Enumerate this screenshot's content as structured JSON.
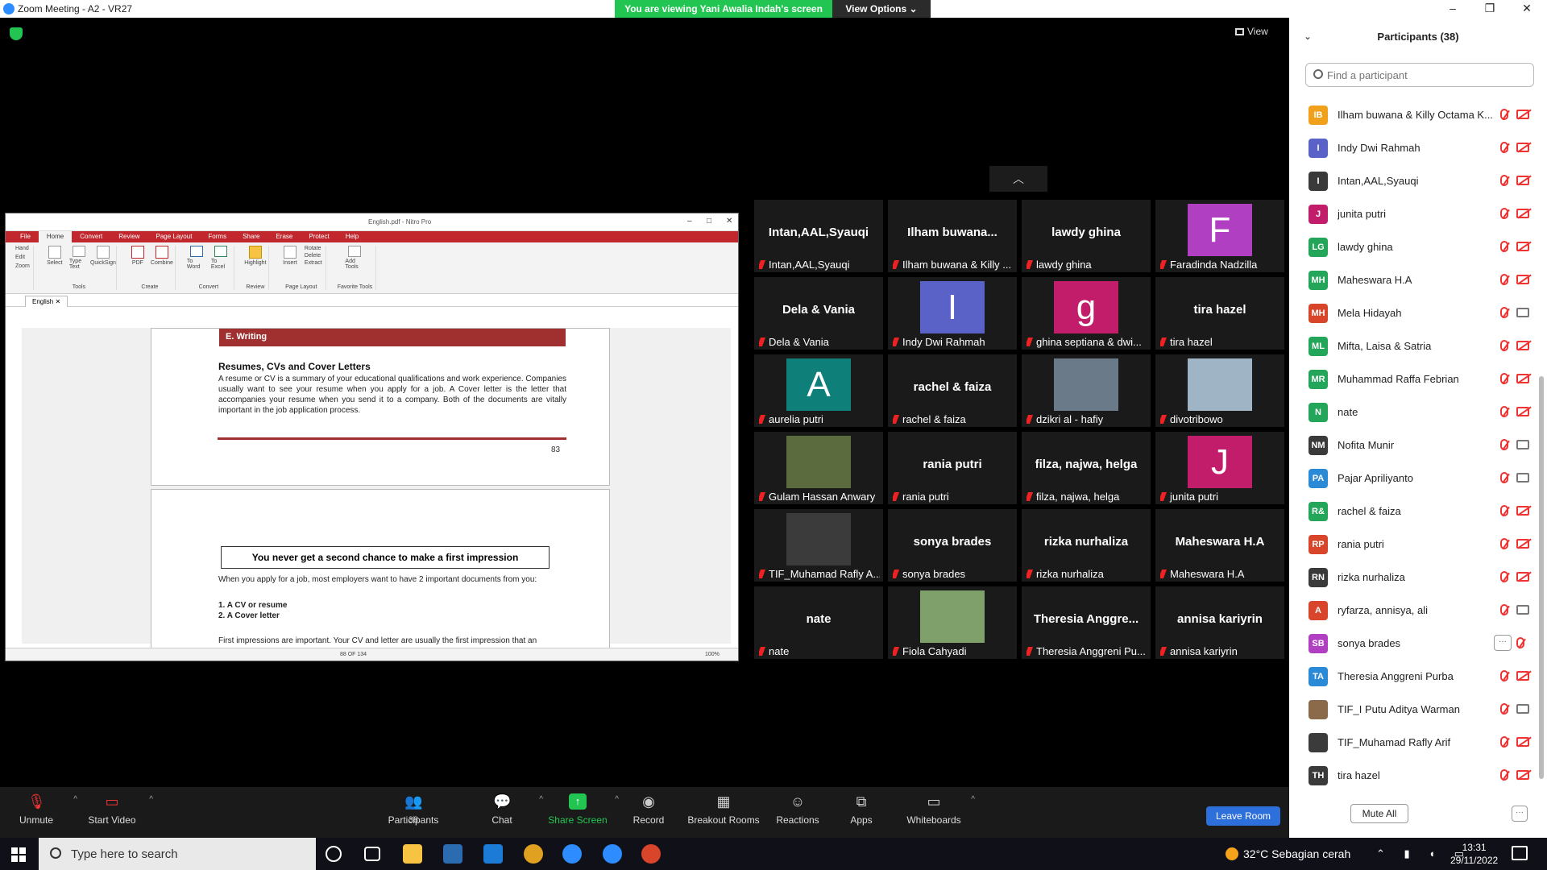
{
  "window": {
    "title": "Zoom Meeting - A2 - VR27"
  },
  "banner": {
    "text": "You are viewing Yani Awalia Indah's screen",
    "view_options": "View Options"
  },
  "view_label": "View",
  "shared_screen": {
    "app_title": "English.pdf - Nitro Pro",
    "menu": [
      "File",
      "Home",
      "Convert",
      "Review",
      "Page Layout",
      "Forms",
      "Share",
      "Erase",
      "Protect",
      "Help"
    ],
    "ribbon_groups": [
      {
        "name": "Tools",
        "items": [
          "Select",
          "Type Text",
          "QuickSign"
        ]
      },
      {
        "name": "Create",
        "items": [
          "PDF",
          "Combine"
        ]
      },
      {
        "name": "Convert",
        "items": [
          "To Word",
          "To Excel"
        ]
      },
      {
        "name": "Review",
        "items": [
          "Highlight"
        ]
      },
      {
        "name": "Page Layout",
        "items": [
          "Insert",
          "Rotate",
          "Delete",
          "Extract"
        ]
      },
      {
        "name": "Favorite Tools",
        "items": [
          "Add Tools"
        ]
      }
    ],
    "side_tools": [
      "Hand",
      "Edit",
      "Zoom"
    ],
    "doc_tab": "English",
    "section_bar": "E. Writing",
    "section_heading": "Resumes, CVs and Cover Letters",
    "section_para": "A resume or CV is a summary of your educational qualifications and work experience. Companies usually want to see your resume when you apply for a job. A Cover letter is the letter that accompanies your resume when you send it to a company. Both of the documents are vitally important in the job application process.",
    "page_number": "83",
    "box_title": "You never get a second chance to make a first impression",
    "p2_intro": "When you apply for a job, most employers want to have 2 important documents from you:",
    "p2_li1": "1. A CV or resume",
    "p2_li2": "2. A Cover letter",
    "p2_first": "First impressions are important. Your CV and letter are usually the first impression that an",
    "page_counter": "88 OF 134",
    "zoom_level": "100%"
  },
  "video_tiles": [
    {
      "label": "Intan,AAL,Syauqi",
      "big": "Intan,AAL,Syauqi"
    },
    {
      "label": "Ilham buwana & Killy ...",
      "big": "Ilham  buwana..."
    },
    {
      "label": "lawdy ghina",
      "big": "lawdy ghina"
    },
    {
      "label": "Faradinda Nadzilla",
      "avatar": "F",
      "color": "#b03fc2"
    },
    {
      "label": "Dela & Vania",
      "big": "Dela & Vania"
    },
    {
      "label": "Indy Dwi Rahmah",
      "avatar": "I",
      "color": "#5a62c7"
    },
    {
      "label": "ghina septiana & dwi...",
      "avatar": "g",
      "color": "#c21d6b"
    },
    {
      "label": "tira hazel",
      "big": "tira hazel"
    },
    {
      "label": "aurelia putri",
      "avatar": "A",
      "color": "#0f7f7a"
    },
    {
      "label": "rachel & faiza",
      "big": "rachel & faiza"
    },
    {
      "label": "dzikri al - hafiy",
      "photo": "#6b7a89"
    },
    {
      "label": "divotribowo",
      "photo": "#9fb4c4"
    },
    {
      "label": "Gulam Hassan Anwary",
      "photo": "#5c6b3d"
    },
    {
      "label": "rania putri",
      "big": "rania putri"
    },
    {
      "label": "filza, najwa, helga",
      "big": "filza, najwa, helga"
    },
    {
      "label": "junita putri",
      "avatar": "J",
      "color": "#c21d6b"
    },
    {
      "label": "TIF_Muhamad Rafly A...",
      "photo": "#3b3b3b"
    },
    {
      "label": "sonya brades",
      "big": "sonya brades"
    },
    {
      "label": "rizka nurhaliza",
      "big": "rizka nurhaliza"
    },
    {
      "label": "Maheswara H.A",
      "big": "Maheswara H.A"
    },
    {
      "label": "nate",
      "big": "nate"
    },
    {
      "label": "Fiola Cahyadi",
      "photo": "#7fa06a"
    },
    {
      "label": "Theresia Anggreni Pu...",
      "big": "Theresia  Anggre..."
    },
    {
      "label": "annisa kariyrin",
      "big": "annisa kariyrin"
    }
  ],
  "toolbar": {
    "unmute": "Unmute",
    "start_video": "Start Video",
    "participants": "Participants",
    "participants_count": "38",
    "chat": "Chat",
    "share_screen": "Share Screen",
    "record": "Record",
    "breakout_rooms": "Breakout Rooms",
    "reactions": "Reactions",
    "apps": "Apps",
    "whiteboards": "Whiteboards",
    "leave_room": "Leave Room"
  },
  "panel": {
    "title": "Participants (38)",
    "search_placeholder": "Find a participant",
    "mute_all": "Mute All",
    "participants": [
      {
        "initials": "IB",
        "name": "Ilham buwana & Killy Octama K...",
        "color": "#f0a01a",
        "cam": "off"
      },
      {
        "initials": "I",
        "name": "Indy Dwi Rahmah",
        "color": "#5a62c7",
        "cam": "off"
      },
      {
        "initials": "I",
        "name": "Intan,AAL,Syauqi",
        "color": "#3a3a3a",
        "cam": "off"
      },
      {
        "initials": "J",
        "name": "junita putri",
        "color": "#c21d6b",
        "cam": "off"
      },
      {
        "initials": "LG",
        "name": "lawdy ghina",
        "color": "#23a55a",
        "cam": "off"
      },
      {
        "initials": "MH",
        "name": "Maheswara H.A",
        "color": "#23a55a",
        "cam": "off"
      },
      {
        "initials": "MH",
        "name": "Mela Hidayah",
        "color": "#d9452b",
        "cam": "on"
      },
      {
        "initials": "ML",
        "name": "Mifta, Laisa & Satria",
        "color": "#23a55a",
        "cam": "off"
      },
      {
        "initials": "MR",
        "name": "Muhammad Raffa Febrian",
        "color": "#23a55a",
        "cam": "off"
      },
      {
        "initials": "N",
        "name": "nate",
        "color": "#23a55a",
        "cam": "off"
      },
      {
        "initials": "NM",
        "name": "Nofita Munir",
        "color": "#3a3a3a",
        "cam": "on"
      },
      {
        "initials": "PA",
        "name": "Pajar Apriliyanto",
        "color": "#2b8ad6",
        "cam": "on"
      },
      {
        "initials": "R&",
        "name": "rachel & faiza",
        "color": "#23a55a",
        "cam": "off"
      },
      {
        "initials": "RP",
        "name": "rania putri",
        "color": "#d9452b",
        "cam": "off"
      },
      {
        "initials": "RN",
        "name": "rizka nurhaliza",
        "color": "#3a3a3a",
        "cam": "off"
      },
      {
        "initials": "A",
        "name": "ryfarza, annisya, ali",
        "color": "#d9452b",
        "cam": "on"
      },
      {
        "initials": "SB",
        "name": "sonya brades",
        "color": "#b03fc2",
        "cam": "more"
      },
      {
        "initials": "TA",
        "name": "Theresia Anggreni Purba",
        "color": "#2b8ad6",
        "cam": "off"
      },
      {
        "initials": "",
        "name": "TIF_I Putu Aditya Warman",
        "color": "#8a6a4a",
        "cam": "on"
      },
      {
        "initials": "",
        "name": "TIF_Muhamad Rafly Arif",
        "color": "#3b3b3b",
        "cam": "off"
      },
      {
        "initials": "TH",
        "name": "tira hazel",
        "color": "#3a3a3a",
        "cam": "off"
      }
    ]
  },
  "taskbar": {
    "search_placeholder": "Type here to search",
    "weather": "32°C  Sebagian cerah",
    "time": "13:31",
    "date": "29/11/2022"
  }
}
